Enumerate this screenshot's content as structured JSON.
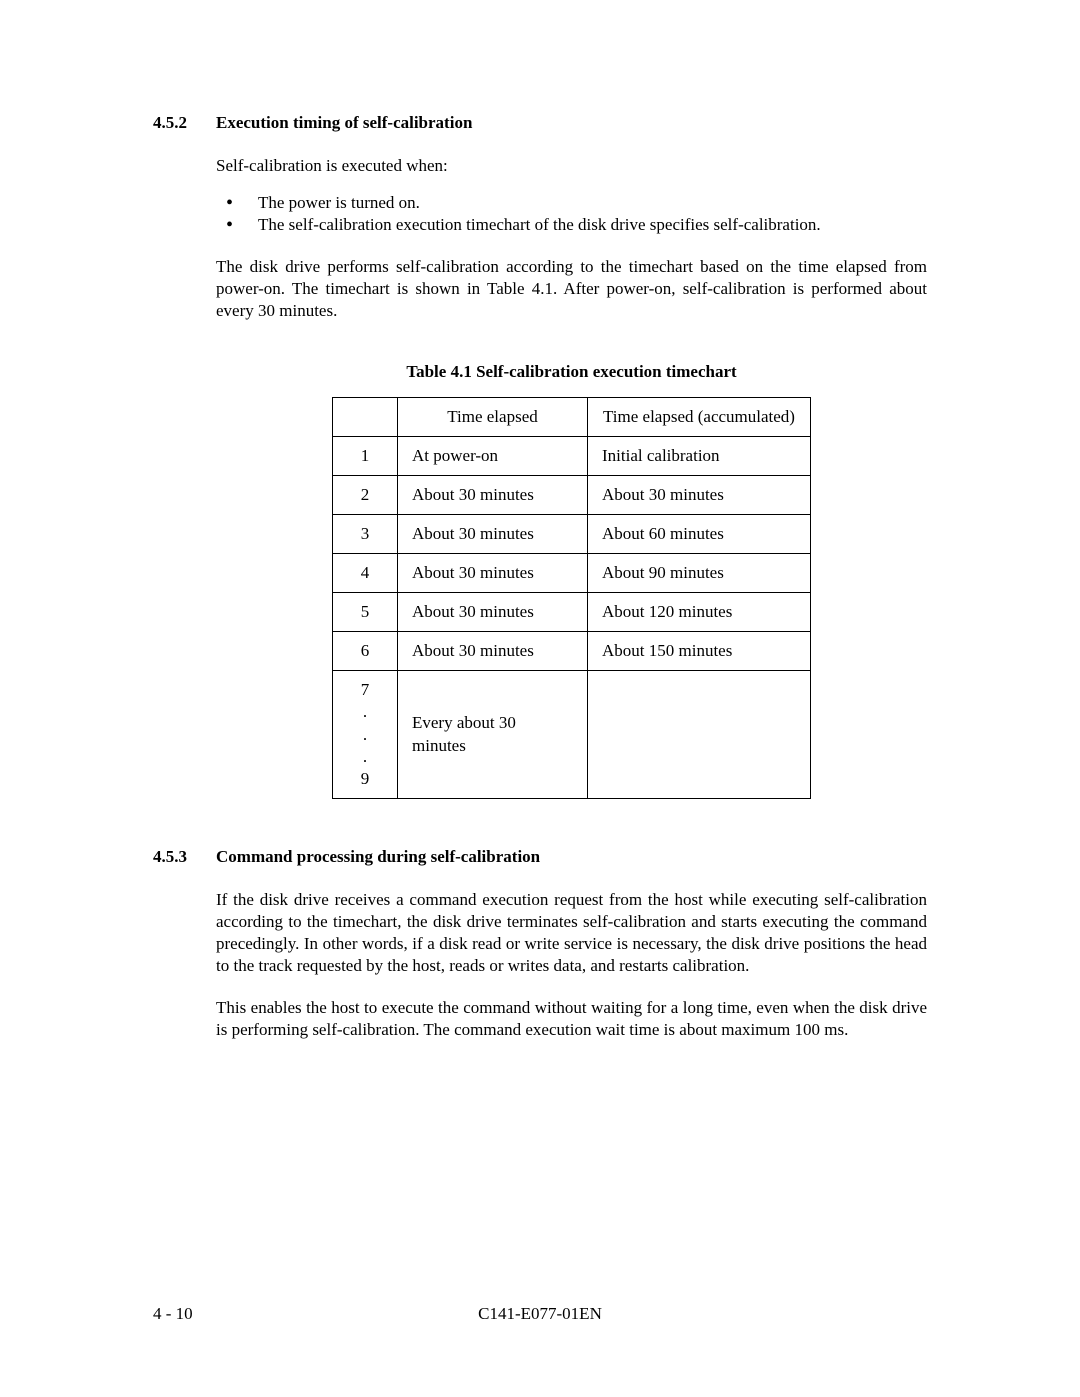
{
  "section_452": {
    "number": "4.5.2",
    "title": "Execution timing of self-calibration",
    "intro": "Self-calibration is executed when:",
    "bullets": [
      "The power is turned on.",
      "The self-calibration execution timechart of the disk drive specifies self-calibration."
    ],
    "para": "The disk drive performs self-calibration according to the timechart based on the time elapsed from power-on.  The timechart is shown in Table 4.1.  After power-on, self-calibration is performed about every 30 minutes."
  },
  "table": {
    "caption": "Table 4.1    Self-calibration execution timechart",
    "headers": {
      "empty": "",
      "col1": "Time elapsed",
      "col2": "Time elapsed (accumulated)"
    },
    "rows": [
      {
        "idx": "1",
        "elapsed": "At power-on",
        "accum": "Initial calibration"
      },
      {
        "idx": "2",
        "elapsed": "About 30 minutes",
        "accum": "About 30 minutes"
      },
      {
        "idx": "3",
        "elapsed": "About 30 minutes",
        "accum": "About 60 minutes"
      },
      {
        "idx": "4",
        "elapsed": "About 30 minutes",
        "accum": "About 90 minutes"
      },
      {
        "idx": "5",
        "elapsed": "About 30 minutes",
        "accum": "About 120 minutes"
      },
      {
        "idx": "6",
        "elapsed": "About 30 minutes",
        "accum": "About 150 minutes"
      }
    ],
    "last_row": {
      "idx_top": "7",
      "idx_bottom": "9",
      "elapsed": "Every about 30 minutes",
      "accum": ""
    }
  },
  "section_453": {
    "number": "4.5.3",
    "title": "Command processing during self-calibration",
    "para1": "If the disk drive receives a command execution request from the host while executing self-calibration according to the timechart, the disk drive terminates self-calibration and starts executing the command precedingly.  In other words, if a disk read or write service is necessary, the disk drive positions the head to the track requested by the host, reads or writes data, and restarts calibration.",
    "para2": "This enables the host to execute the command without waiting for a long time, even when the disk drive is performing self-calibration.  The command execution wait time is about maximum 100 ms."
  },
  "footer": {
    "page": "4 - 10",
    "doc": "C141-E077-01EN"
  },
  "chart_data": {
    "type": "table",
    "title": "Table 4.1 Self-calibration execution timechart",
    "columns": [
      "",
      "Time elapsed",
      "Time elapsed (accumulated)"
    ],
    "rows": [
      [
        "1",
        "At power-on",
        "Initial calibration"
      ],
      [
        "2",
        "About 30 minutes",
        "About 30 minutes"
      ],
      [
        "3",
        "About 30 minutes",
        "About 60 minutes"
      ],
      [
        "4",
        "About 30 minutes",
        "About 90 minutes"
      ],
      [
        "5",
        "About 30 minutes",
        "About 120 minutes"
      ],
      [
        "6",
        "About 30 minutes",
        "About 150 minutes"
      ],
      [
        "7 . . . 9",
        "Every about 30 minutes",
        ""
      ]
    ]
  }
}
